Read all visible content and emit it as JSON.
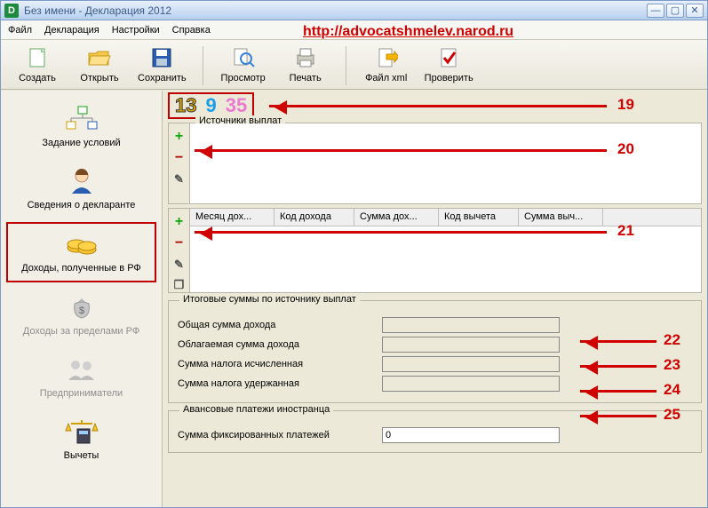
{
  "window": {
    "title": "Без имени - Декларация 2012",
    "app_icon_letter": "D"
  },
  "menu": {
    "file": "Файл",
    "declaration": "Декларация",
    "settings": "Настройки",
    "help": "Справка"
  },
  "overlay_url": "http://advocatshmelev.narod.ru",
  "toolbar": {
    "create": "Создать",
    "open": "Открыть",
    "save": "Сохранить",
    "preview": "Просмотр",
    "print": "Печать",
    "xml": "Файл xml",
    "check": "Проверить"
  },
  "sidebar": {
    "conditions": "Задание условий",
    "declarant": "Сведения о декларанте",
    "income_rf": "Доходы, полученные в РФ",
    "income_abroad": "Доходы за пределами РФ",
    "entrepreneurs": "Предприниматели",
    "deductions": "Вычеты"
  },
  "rates": {
    "r13": "13",
    "r9": "9",
    "r35": "35"
  },
  "sources": {
    "title": "Источники выплат"
  },
  "details": {
    "cols": {
      "month": "Месяц дох...",
      "code_income": "Код дохода",
      "sum_income": "Сумма дох...",
      "code_ded": "Код вычета",
      "sum_ded": "Сумма выч..."
    }
  },
  "totals": {
    "group": "Итоговые суммы по источнику выплат",
    "total_income": "Общая сумма дохода",
    "taxable_income": "Облагаемая сумма дохода",
    "tax_calculated": "Сумма налога исчисленная",
    "tax_withheld": "Сумма налога удержанная"
  },
  "advances": {
    "group": "Авансовые платежи иностранца",
    "fixed_payments_label": "Сумма фиксированных платежей",
    "fixed_payments_value": "0"
  },
  "callouts": {
    "c19": "19",
    "c20": "20",
    "c21": "21",
    "c22": "22",
    "c23": "23",
    "c24": "24",
    "c25": "25"
  }
}
